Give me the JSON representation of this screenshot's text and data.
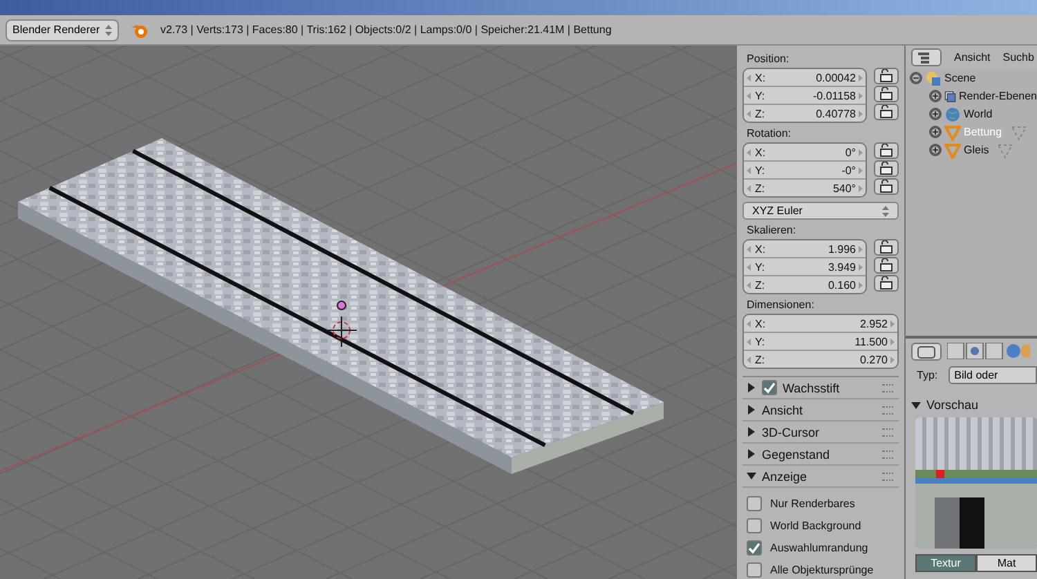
{
  "header": {
    "render_engine": "Blender Renderer",
    "stats": "v2.73 | Verts:173 | Faces:80 | Tris:162 | Objects:0/2 | Lamps:0/0 | Speicher:21.41M | Bettung"
  },
  "transform": [
    {
      "label": "Position:",
      "locks": true,
      "fields": [
        {
          "axis": "X:",
          "value": "0.00042"
        },
        {
          "axis": "Y:",
          "value": "-0.01158"
        },
        {
          "axis": "Z:",
          "value": "0.40778"
        }
      ]
    },
    {
      "label": "Rotation:",
      "locks": true,
      "fields": [
        {
          "axis": "X:",
          "value": "0°"
        },
        {
          "axis": "Y:",
          "value": "-0°"
        },
        {
          "axis": "Z:",
          "value": "540°"
        }
      ],
      "mode": "XYZ Euler"
    },
    {
      "label": "Skalieren:",
      "locks": true,
      "fields": [
        {
          "axis": "X:",
          "value": "1.996"
        },
        {
          "axis": "Y:",
          "value": "3.949"
        },
        {
          "axis": "Z:",
          "value": "0.160"
        }
      ]
    },
    {
      "label": "Dimensionen:",
      "locks": false,
      "fields": [
        {
          "axis": "X:",
          "value": "2.952"
        },
        {
          "axis": "Y:",
          "value": "11.500"
        },
        {
          "axis": "Z:",
          "value": "0.270"
        }
      ]
    }
  ],
  "panels": [
    {
      "label": "Wachsstift",
      "expanded": false,
      "checkbox": true,
      "checked": true
    },
    {
      "label": "Ansicht",
      "expanded": false,
      "checkbox": false
    },
    {
      "label": "3D-Cursor",
      "expanded": false,
      "checkbox": false
    },
    {
      "label": "Gegenstand",
      "expanded": false,
      "checkbox": false
    },
    {
      "label": "Anzeige",
      "expanded": true,
      "checkbox": false,
      "options": [
        {
          "label": "Nur Renderbares",
          "checked": false
        },
        {
          "label": "World Background",
          "checked": false
        },
        {
          "label": "Auswahlumrandung",
          "checked": true
        },
        {
          "label": "Alle Objektursprünge",
          "checked": false
        }
      ]
    }
  ],
  "outliner": {
    "menu": [
      "Ansicht",
      "Suchb"
    ],
    "tree": [
      {
        "label": "Scene",
        "kind": "scene",
        "expanded": true,
        "selected": false,
        "children": [
          {
            "label": "Render-Ebenen",
            "kind": "layers",
            "selected": false
          },
          {
            "label": "World",
            "kind": "world",
            "selected": false
          },
          {
            "label": "Bettung",
            "kind": "mesh",
            "selected": true
          },
          {
            "label": "Gleis",
            "kind": "mesh",
            "selected": false
          }
        ]
      }
    ]
  },
  "properties": {
    "type_label": "Typ:",
    "type_value": "Bild oder",
    "section": "Vorschau",
    "tabs": [
      {
        "label": "Textur",
        "selected": true
      },
      {
        "label": "Mat",
        "selected": false
      }
    ]
  }
}
